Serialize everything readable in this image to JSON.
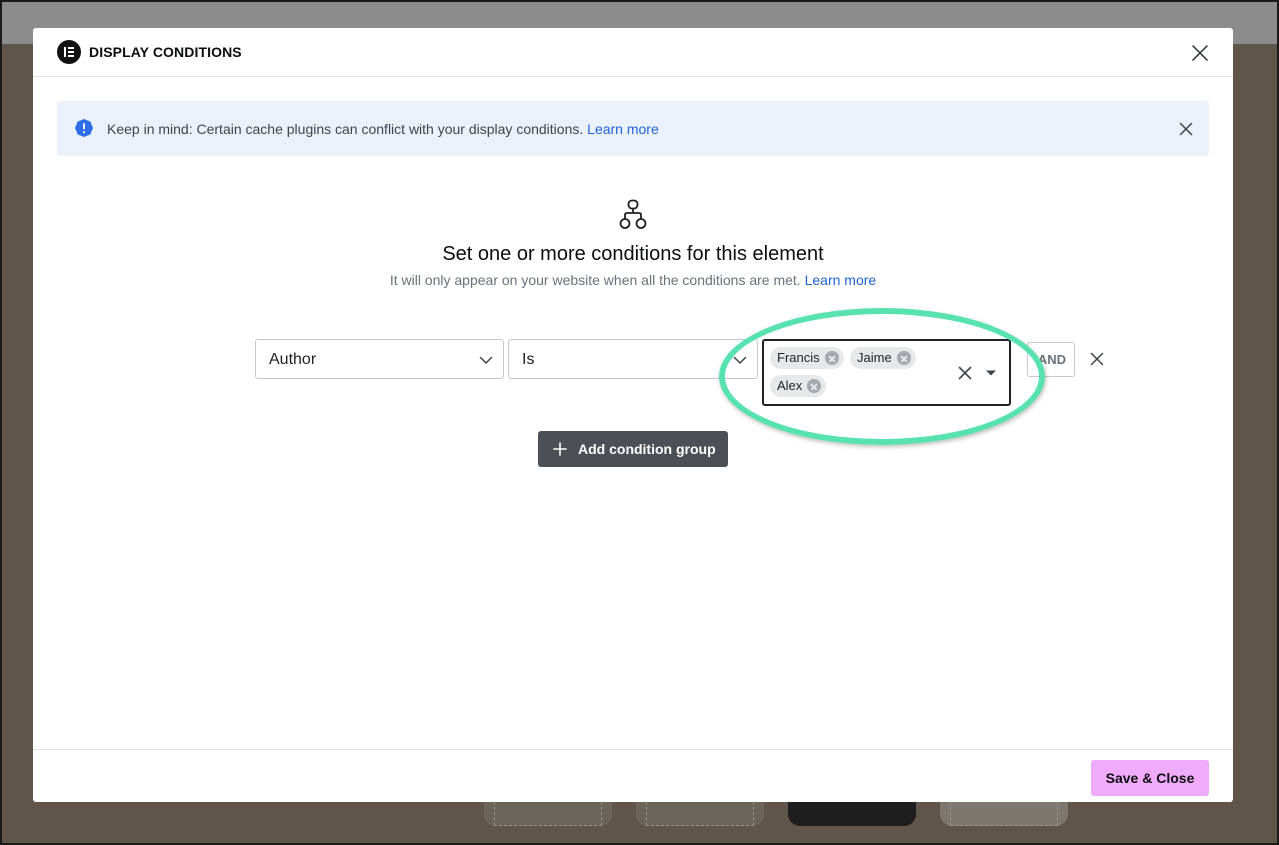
{
  "modal": {
    "title": "DISPLAY CONDITIONS"
  },
  "alert": {
    "message": "Keep in mind: Certain cache plugins can conflict with your display conditions.",
    "link": "Learn more"
  },
  "intro": {
    "title": "Set one or more conditions for this element",
    "subtitle": "It will only appear on your website when all the conditions are met.",
    "link": "Learn more"
  },
  "condition": {
    "field": "Author",
    "operator": "Is",
    "values": [
      "Francis",
      "Jaime",
      "Alex"
    ],
    "connector": "AND"
  },
  "actions": {
    "add_group": "Add condition group",
    "save": "Save & Close"
  },
  "colors": {
    "save_button": "#f0abfc",
    "alert_background": "#ebf1fb",
    "link": "#1f63d9",
    "highlight_ring": "#57e2b0",
    "add_button": "#4b5057"
  },
  "icons": {
    "logo": "elementor-logo-icon",
    "alert": "info-icon",
    "hero": "sitemap-icon"
  }
}
